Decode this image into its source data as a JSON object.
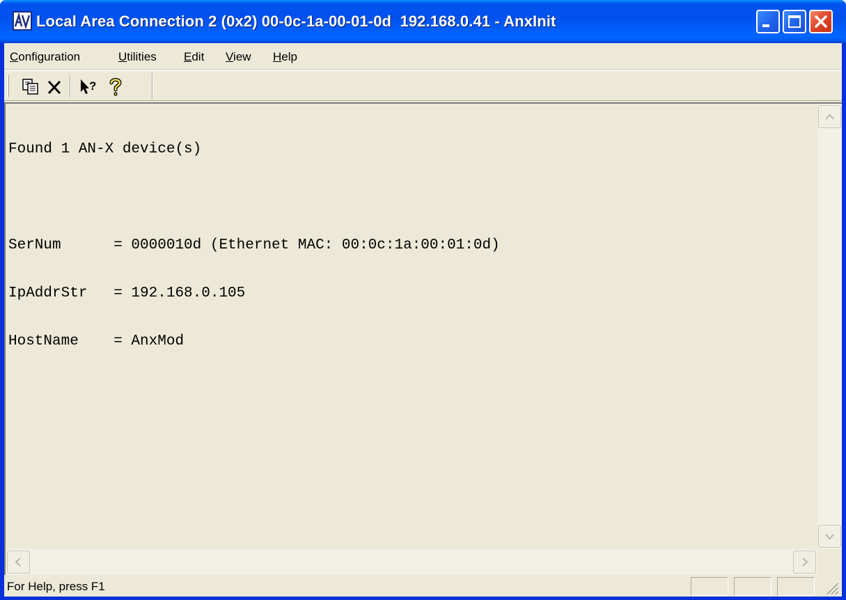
{
  "window": {
    "title": "Local Area Connection 2 (0x2) 00-0c-1a-00-01-0d  192.168.0.41 - AnxInit",
    "app_icon": "anx-logo-icon",
    "controls": [
      "minimize-icon",
      "maximize-icon",
      "close-icon"
    ]
  },
  "menubar": {
    "items": [
      {
        "pre": "",
        "ul": "C",
        "post": "onfiguration"
      },
      {
        "pre": "",
        "ul": "U",
        "post": "tilities"
      },
      {
        "pre": "",
        "ul": "E",
        "post": "dit"
      },
      {
        "pre": "",
        "ul": "V",
        "post": "iew"
      },
      {
        "pre": "",
        "ul": "H",
        "post": "elp"
      }
    ]
  },
  "toolbar": {
    "buttons": [
      "copy-icon",
      "delete-icon",
      "context-help-icon",
      "help-icon"
    ]
  },
  "output": {
    "lines": [
      "Found 1 AN-X device(s)",
      "",
      "SerNum      = 0000010d (Ethernet MAC: 00:0c:1a:00:01:0d)",
      "IpAddrStr   = 192.168.0.105",
      "HostName    = AnxMod"
    ]
  },
  "statusbar": {
    "text": "For Help, press F1"
  },
  "colors": {
    "title_bar": "#0053ee",
    "window_face": "#ece9d8",
    "close_button": "#e0442a"
  }
}
